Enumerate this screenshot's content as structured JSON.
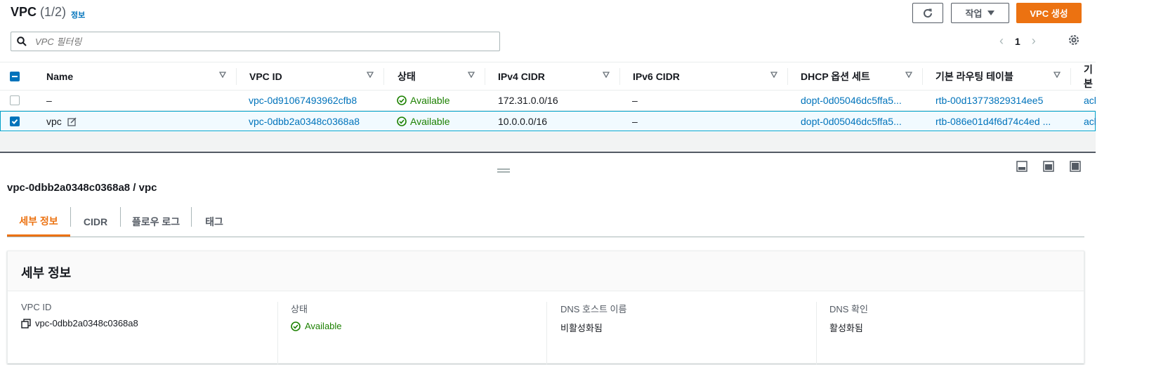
{
  "header": {
    "title": "VPC",
    "count": "(1/2)",
    "info_link": "정보",
    "action_label": "작업",
    "create_label": "VPC 생성"
  },
  "search": {
    "placeholder": "VPC 필터링"
  },
  "pagination": {
    "page": "1"
  },
  "table": {
    "columns": [
      "Name",
      "VPC ID",
      "상태",
      "IPv4 CIDR",
      "IPv6 CIDR",
      "DHCP 옵션 세트",
      "기본 라우팅 테이블",
      "기본"
    ],
    "rows": [
      {
        "name": "–",
        "vpc_id": "vpc-0d91067493962cfb8",
        "status": "Available",
        "ipv4": "172.31.0.0/16",
        "ipv6": "–",
        "dhcp": "dopt-0d05046dc5ffa5...",
        "route_table": "rtb-00d13773829314ee5",
        "acl": "acl",
        "selected": false
      },
      {
        "name": "vpc",
        "vpc_id": "vpc-0dbb2a0348c0368a8",
        "status": "Available",
        "ipv4": "10.0.0.0/16",
        "ipv6": "–",
        "dhcp": "dopt-0d05046dc5ffa5...",
        "route_table": "rtb-086e01d4f6d74c4ed ...",
        "acl": "acl",
        "selected": true
      }
    ]
  },
  "detail": {
    "title": "vpc-0dbb2a0348c0368a8 / vpc",
    "tabs": [
      "세부 정보",
      "CIDR",
      "플로우 로그",
      "태그"
    ],
    "active_tab": "세부 정보",
    "section_title": "세부 정보",
    "fields": [
      {
        "label": "VPC ID",
        "value": "vpc-0dbb2a0348c0368a8"
      },
      {
        "label": "상태",
        "value": "Available"
      },
      {
        "label": "DNS 호스트 이름",
        "value": "비활성화됨"
      },
      {
        "label": "DNS 확인",
        "value": "활성화됨"
      }
    ]
  },
  "colors": {
    "accent_orange": "#ec7211",
    "link_blue": "#0073bb",
    "success_green": "#1d8102",
    "selected_row_bg": "#f1faff"
  }
}
